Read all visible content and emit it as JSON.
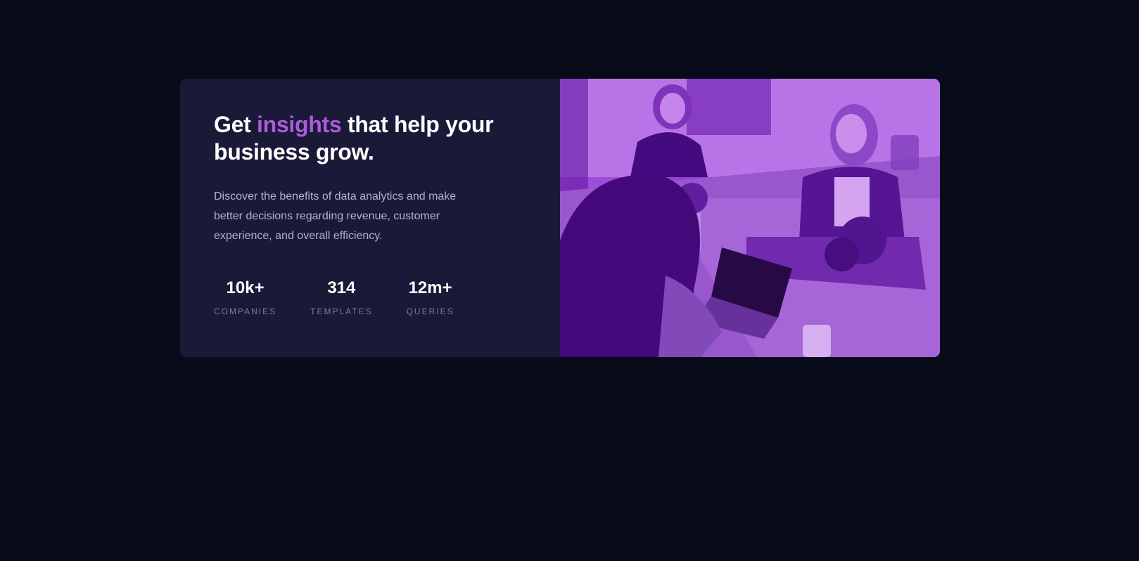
{
  "card": {
    "headline_before": "Get ",
    "headline_accent": "insights",
    "headline_after": " that help your business grow.",
    "description": "Discover the benefits of data analytics and make better decisions regarding revenue, customer experience, and overall efficiency.",
    "stats": [
      {
        "value": "10k+",
        "label": "COMPANIES"
      },
      {
        "value": "314",
        "label": "TEMPLATES"
      },
      {
        "value": "12m+",
        "label": "QUERIES"
      }
    ]
  },
  "colors": {
    "page_bg": "#080b1a",
    "card_bg": "#1b1938",
    "accent": "#ab5cdb",
    "text_primary": "#ffffff",
    "text_secondary": "#b5b3c4",
    "text_muted": "#7e7c94"
  }
}
